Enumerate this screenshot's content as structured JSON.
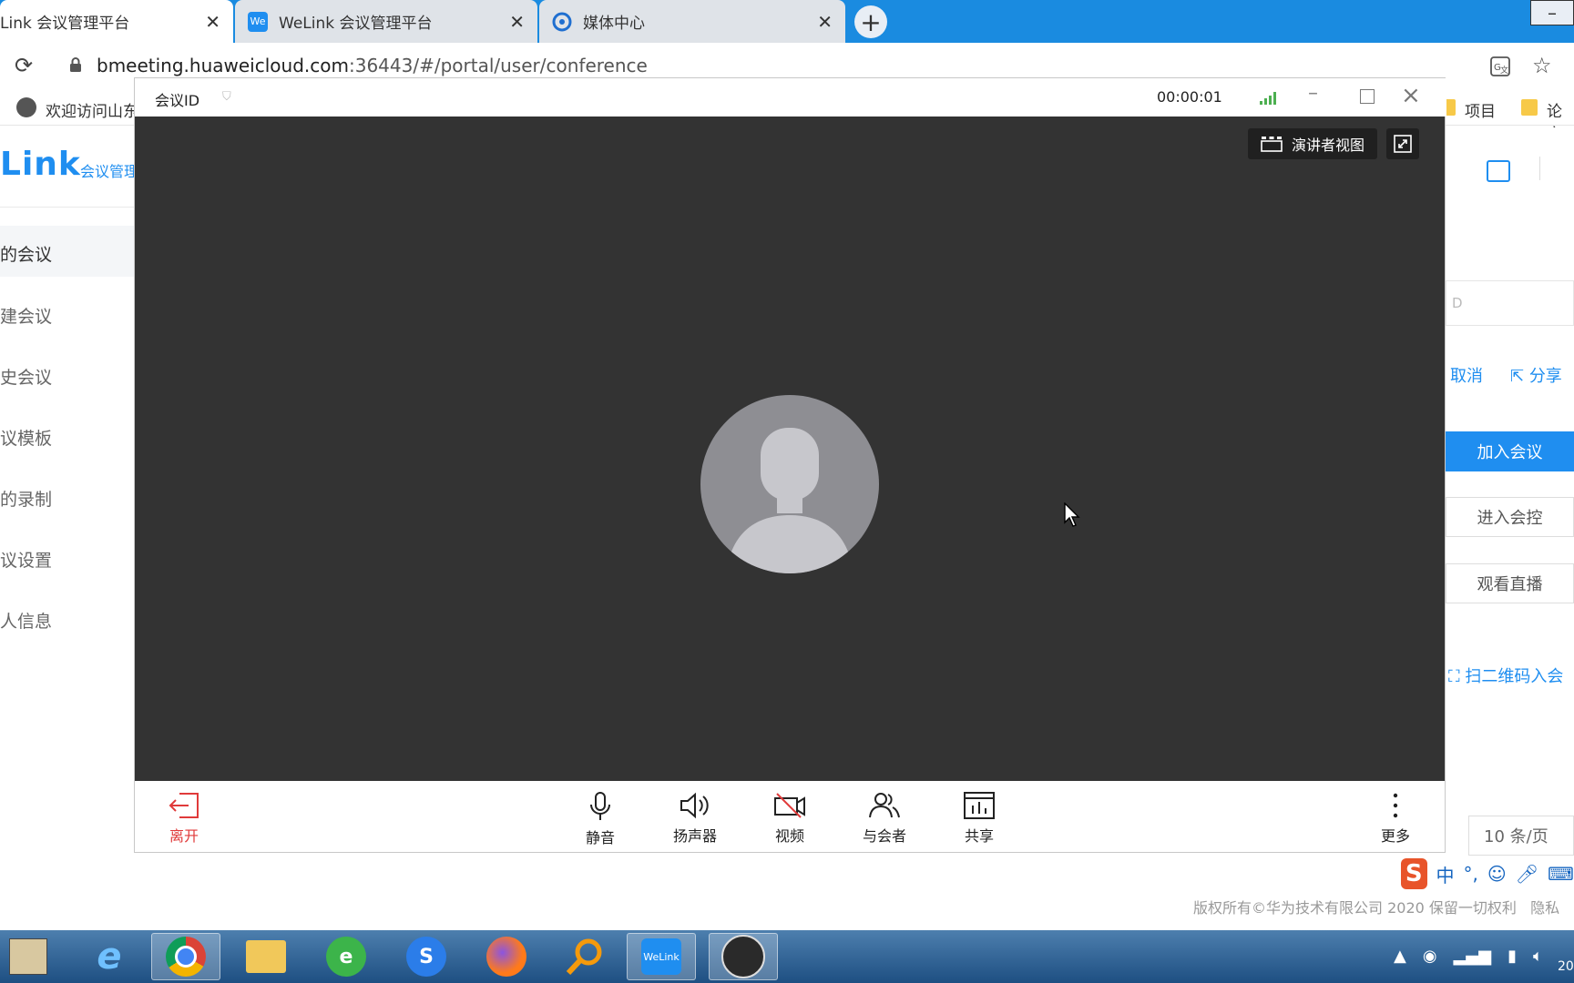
{
  "browser": {
    "tabs": [
      {
        "title": "Link 会议管理平台",
        "close": "✕"
      },
      {
        "title": "WeLink 会议管理平台",
        "favicon": "We",
        "close": "✕"
      },
      {
        "title": "媒体中心",
        "close": "✕"
      }
    ],
    "new_tab": "+",
    "url_host": "bmeeting.huaweicloud.com",
    "url_path": ":36443/#/portal/user/conference",
    "bookmarks": [
      {
        "label": "欢迎访问山东"
      },
      {
        "label": "项目"
      },
      {
        "label": "论文"
      }
    ]
  },
  "page": {
    "logo": "Link",
    "logo_sub": "会议管理",
    "nav": [
      "的会议",
      "建会议",
      "史会议",
      "议模板",
      "的录制",
      "议设置",
      "人信息"
    ],
    "search_placeholder": "D",
    "cancel_link": "取消",
    "share_link": "分享",
    "join_button": "加入会议",
    "control_button": "进入会控",
    "live_button": "观看直播",
    "qr_link": "扫二维码入会",
    "pager": "10 条/页",
    "footer": "版权所有©华为技术有限公司 2020 保留一切权利",
    "footer_tail": "隐私"
  },
  "meeting": {
    "title": "会议ID",
    "timer": "00:00:01",
    "presenter_view": "演讲者视图",
    "toolbar": {
      "leave": "离开",
      "mute": "静音",
      "speaker": "扬声器",
      "video": "视频",
      "participants": "与会者",
      "share": "共享",
      "more": "更多"
    }
  },
  "ime": {
    "logo": "S",
    "mode": "中"
  },
  "taskbar": {
    "welink": "WeLink",
    "clock": "20"
  },
  "colors": {
    "tabstrip": "#1a8be0",
    "brand": "#1f8ef0",
    "video_bg": "#333333",
    "leave_red": "#e03a3a"
  }
}
